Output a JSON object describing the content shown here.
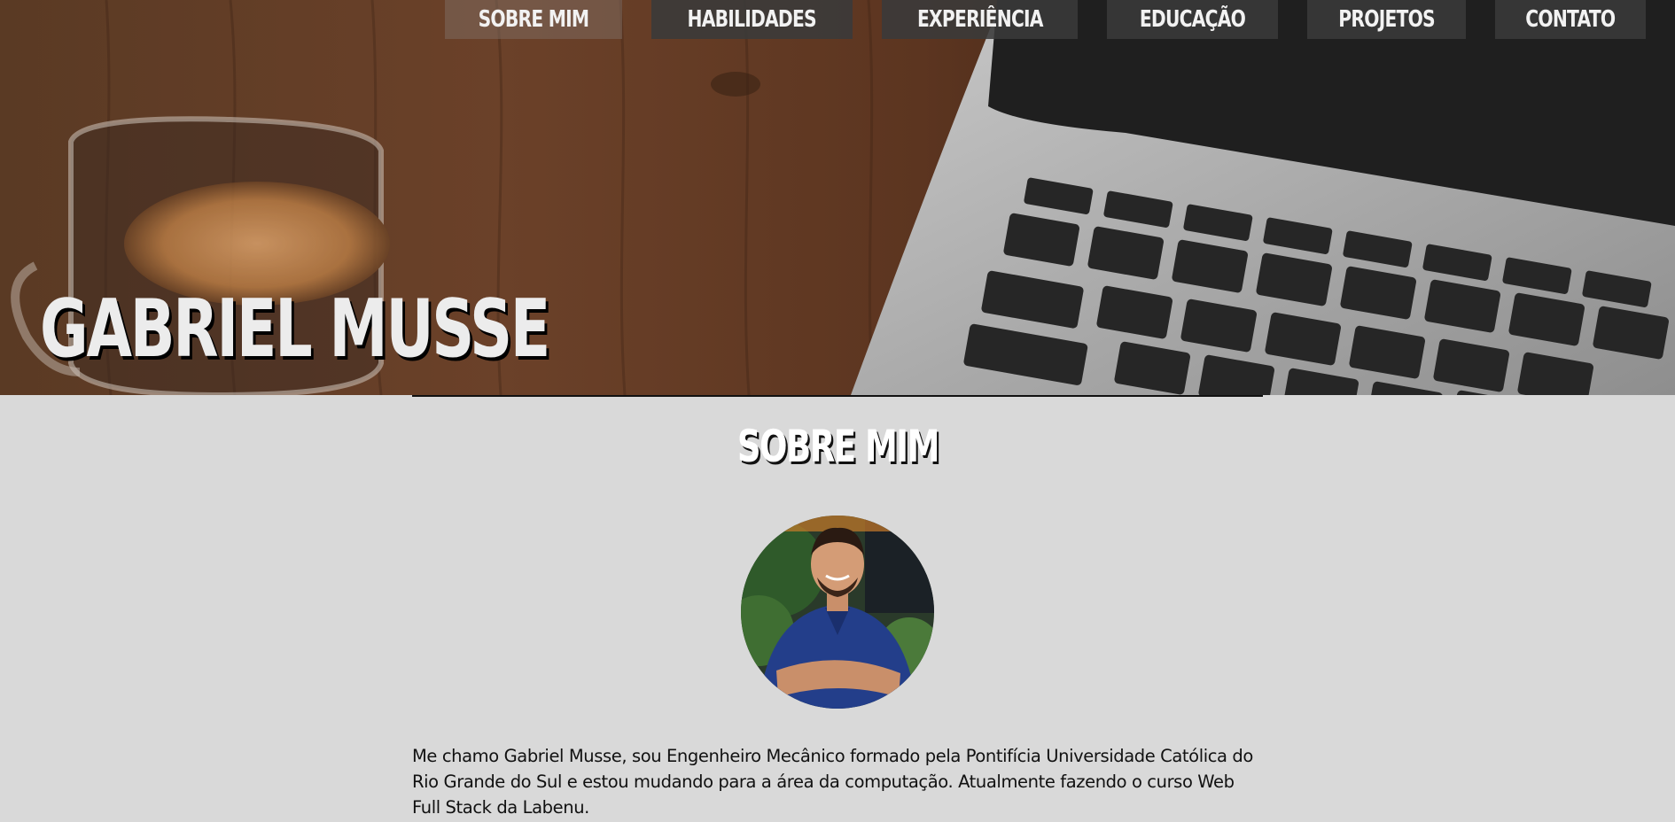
{
  "hero": {
    "name": "GABRIEL MUSSE",
    "background_image": "coffee-cup-and-laptop-on-wooden-desk"
  },
  "nav": {
    "items": [
      {
        "label": "SOBRE MIM",
        "active": true
      },
      {
        "label": "HABILIDADES",
        "active": false
      },
      {
        "label": "EXPERIÊNCIA",
        "active": false
      },
      {
        "label": "EDUCAÇÃO",
        "active": false
      },
      {
        "label": "PROJETOS",
        "active": false
      },
      {
        "label": "CONTATO",
        "active": false
      }
    ]
  },
  "about": {
    "title": "SOBRE MIM",
    "photo": "profile-photo-man-blue-polo",
    "bio": "Me chamo Gabriel Musse, sou Engenheiro Mecânico formado pela Pontifícia Universidade Católica do Rio Grande do Sul e estou mudando para a área da computação. Atualmente fazendo o curso Web Full Stack da Labenu."
  },
  "colors": {
    "page_background": "#d9d9d9",
    "nav_background": "#3a3a3a",
    "nav_text": "#f2f2f2",
    "hero_name": "#ececec",
    "body_text": "#111111"
  }
}
